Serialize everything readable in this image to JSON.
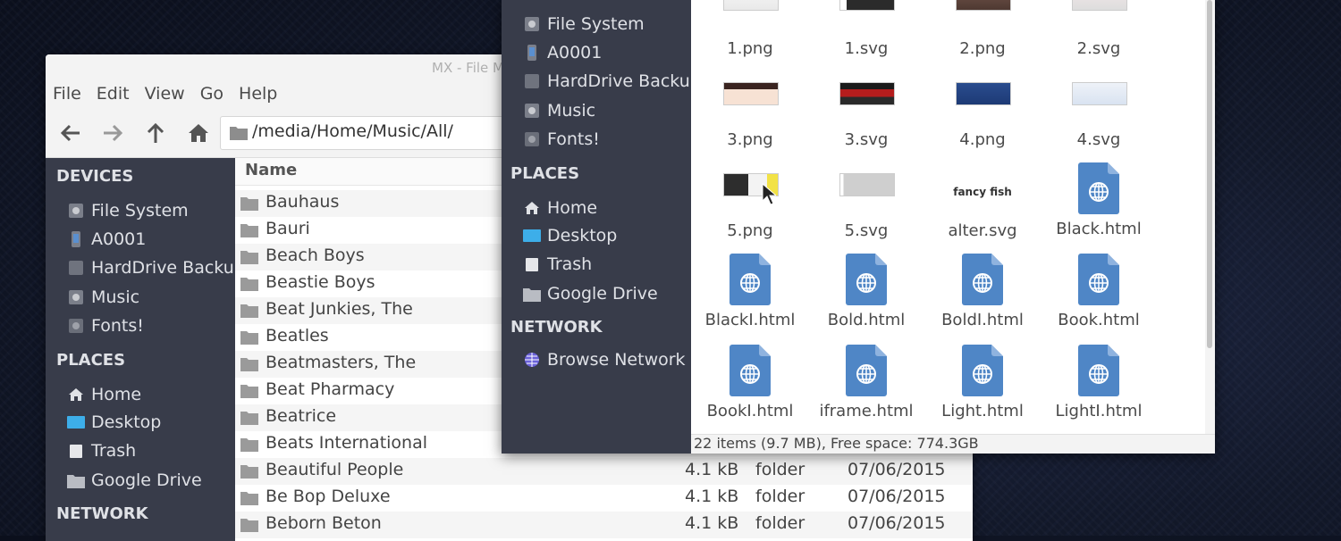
{
  "back_window": {
    "title": "MX - File M",
    "menu": [
      "File",
      "Edit",
      "View",
      "Go",
      "Help"
    ],
    "path": "/media/Home/Music/All/",
    "sidebar": {
      "devices_heading": "DEVICES",
      "devices": [
        "File System",
        "A0001",
        "HardDrive Backup",
        "Music",
        "Fonts!"
      ],
      "places_heading": "PLACES",
      "places": [
        "Home",
        "Desktop",
        "Trash",
        "Google Drive"
      ],
      "network_heading": "NETWORK"
    },
    "list_header": "Name",
    "rows": [
      {
        "name": "Bauhaus",
        "size": "",
        "type": "",
        "date": ""
      },
      {
        "name": "Bauri",
        "size": "",
        "type": "",
        "date": ""
      },
      {
        "name": "Beach Boys",
        "size": "",
        "type": "",
        "date": ""
      },
      {
        "name": "Beastie Boys",
        "size": "",
        "type": "",
        "date": ""
      },
      {
        "name": "Beat Junkies, The",
        "size": "",
        "type": "",
        "date": ""
      },
      {
        "name": "Beatles",
        "size": "",
        "type": "",
        "date": ""
      },
      {
        "name": "Beatmasters, The",
        "size": "",
        "type": "",
        "date": ""
      },
      {
        "name": "Beat Pharmacy",
        "size": "",
        "type": "",
        "date": ""
      },
      {
        "name": "Beatrice",
        "size": "",
        "type": "",
        "date": ""
      },
      {
        "name": "Beats International",
        "size": "",
        "type": "",
        "date": ""
      },
      {
        "name": "Beautiful People",
        "size": "4.1 kB",
        "type": "folder",
        "date": "07/06/2015"
      },
      {
        "name": "Be Bop Deluxe",
        "size": "4.1 kB",
        "type": "folder",
        "date": "07/06/2015"
      },
      {
        "name": "Beborn Beton",
        "size": "4.1 kB",
        "type": "folder",
        "date": "07/06/2015"
      }
    ]
  },
  "front_window": {
    "sidebar": {
      "devices": [
        "File System",
        "A0001",
        "HardDrive Backup",
        "Music",
        "Fonts!"
      ],
      "places_heading": "PLACES",
      "places": [
        "Home",
        "Desktop",
        "Trash",
        "Google Drive"
      ],
      "network_heading": "NETWORK",
      "network": [
        "Browse Network"
      ]
    },
    "files": [
      {
        "name": "1.png",
        "kind": "thumb",
        "thumb": "doc-light"
      },
      {
        "name": "1.svg",
        "kind": "thumb",
        "thumb": "dark"
      },
      {
        "name": "2.png",
        "kind": "thumb",
        "thumb": "brown"
      },
      {
        "name": "2.svg",
        "kind": "thumb",
        "thumb": "pale"
      },
      {
        "name": "3.png",
        "kind": "thumb",
        "thumb": "peach"
      },
      {
        "name": "3.svg",
        "kind": "thumb",
        "thumb": "red"
      },
      {
        "name": "4.png",
        "kind": "thumb",
        "thumb": "navy"
      },
      {
        "name": "4.svg",
        "kind": "thumb",
        "thumb": "light-blue"
      },
      {
        "name": "5.png",
        "kind": "thumb",
        "thumb": "dark-yellow"
      },
      {
        "name": "5.svg",
        "kind": "thumb",
        "thumb": "grey"
      },
      {
        "name": "alter.svg",
        "kind": "text",
        "preview": "fancy fish"
      },
      {
        "name": "Black.html",
        "kind": "html"
      },
      {
        "name": "BlackI.html",
        "kind": "html"
      },
      {
        "name": "Bold.html",
        "kind": "html"
      },
      {
        "name": "BoldI.html",
        "kind": "html"
      },
      {
        "name": "Book.html",
        "kind": "html"
      },
      {
        "name": "BookI.html",
        "kind": "html"
      },
      {
        "name": "iframe.html",
        "kind": "html"
      },
      {
        "name": "Light.html",
        "kind": "html"
      },
      {
        "name": "LightI.html",
        "kind": "html"
      }
    ],
    "status": "22 items (9.7 MB), Free space:  774.3GB"
  },
  "icons": {
    "back": "arrow-left-icon",
    "forward": "arrow-right-icon",
    "up": "arrow-up-icon",
    "home": "home-icon",
    "drive": "drive-icon",
    "phone": "phone-icon",
    "folder": "folder-icon",
    "trash": "trash-icon",
    "desktop": "desktop-icon",
    "network": "globe-icon",
    "html": "html-file-icon"
  },
  "colors": {
    "sidebar": "#383c4a",
    "html_icon": "#4f86c6",
    "desktop_icon": "#3daee9"
  }
}
